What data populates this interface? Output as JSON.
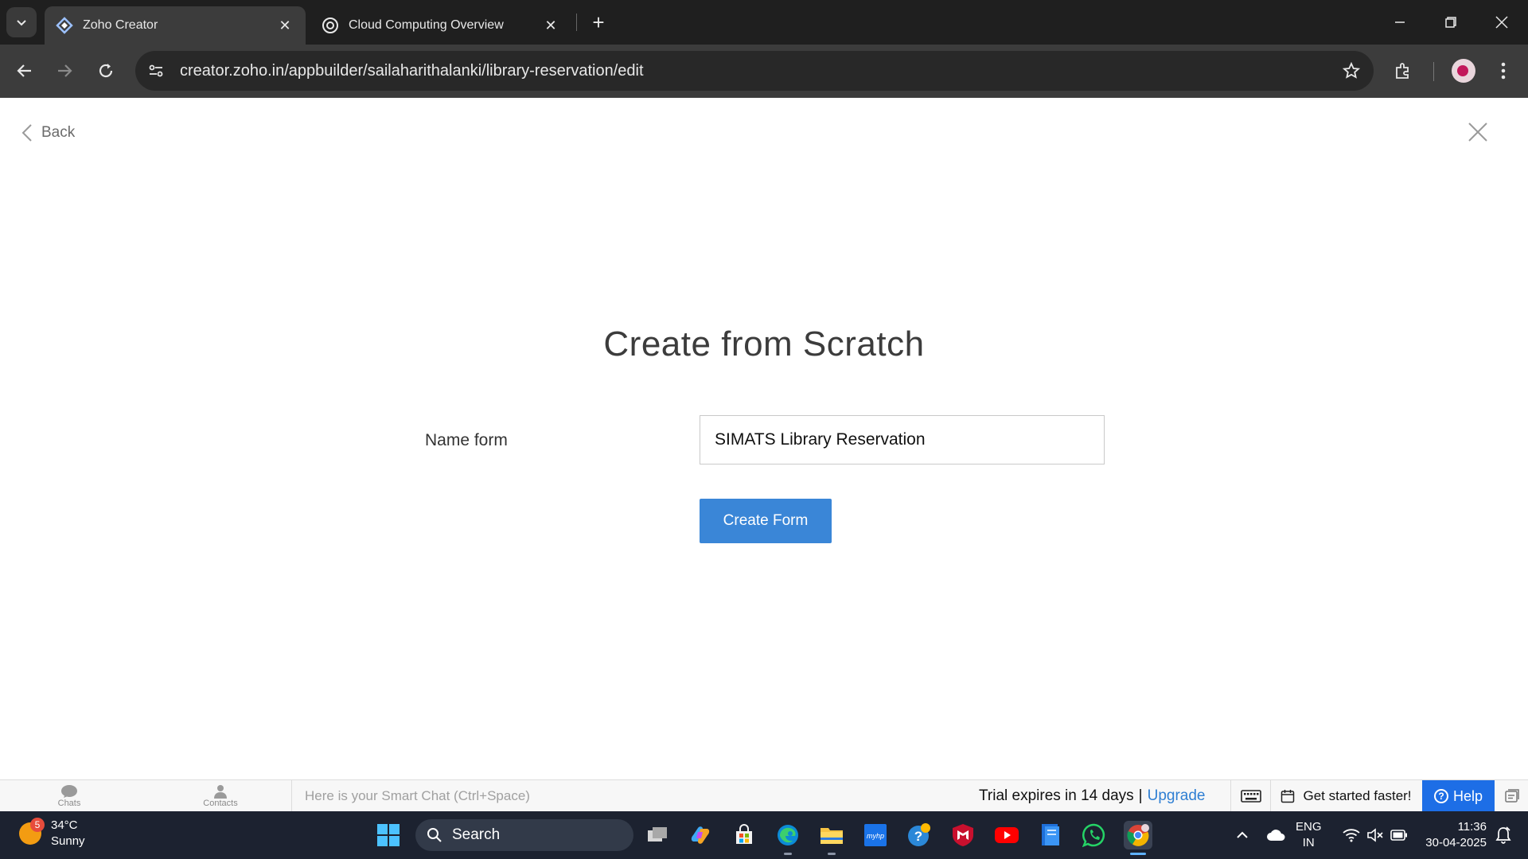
{
  "browser": {
    "tabs": [
      {
        "title": "Zoho Creator",
        "active": true
      },
      {
        "title": "Cloud Computing Overview",
        "active": false
      }
    ],
    "url": "creator.zoho.in/appbuilder/sailaharithalanki/library-reservation/edit"
  },
  "page": {
    "back_label": "Back",
    "heading": "Create from Scratch",
    "form": {
      "name_label": "Name form",
      "name_value": "SIMATS Library Reservation",
      "submit_label": "Create Form"
    }
  },
  "zoho_bar": {
    "chats_label": "Chats",
    "contacts_label": "Contacts",
    "smart_chat_placeholder": "Here is your Smart Chat (Ctrl+Space)",
    "trial_text": "Trial expires in 14 days",
    "trial_separator": "|",
    "upgrade_label": "Upgrade",
    "get_started_label": "Get started faster!",
    "help_label": "Help"
  },
  "taskbar": {
    "weather": {
      "temp": "34°C",
      "condition": "Sunny",
      "badge": "5"
    },
    "search_label": "Search",
    "language": {
      "line1": "ENG",
      "line2": "IN"
    },
    "time": "11:36",
    "date": "30-04-2025"
  },
  "colors": {
    "accent_button": "#3a86d7",
    "help_button": "#1d6ee6",
    "upgrade_link": "#2f7fd3"
  }
}
